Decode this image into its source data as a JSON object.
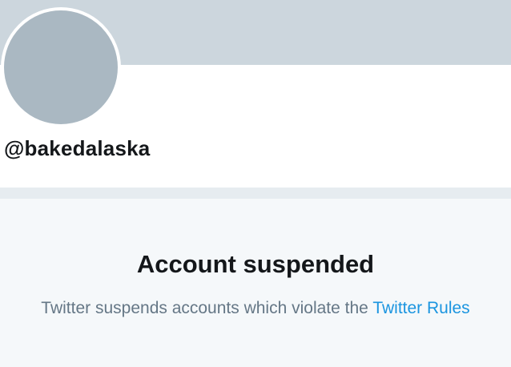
{
  "profile": {
    "handle": "@bakedalaska"
  },
  "notice": {
    "title": "Account suspended",
    "message": "Twitter suspends accounts which violate the ",
    "link_label": "Twitter Rules"
  },
  "colors": {
    "banner": "#ccd6dd",
    "avatar": "#aab8c2",
    "divider": "#e6ecf0",
    "notice_bg": "#f5f8fa",
    "text_primary": "#14171a",
    "text_secondary": "#657786",
    "link": "#1b95e0"
  }
}
